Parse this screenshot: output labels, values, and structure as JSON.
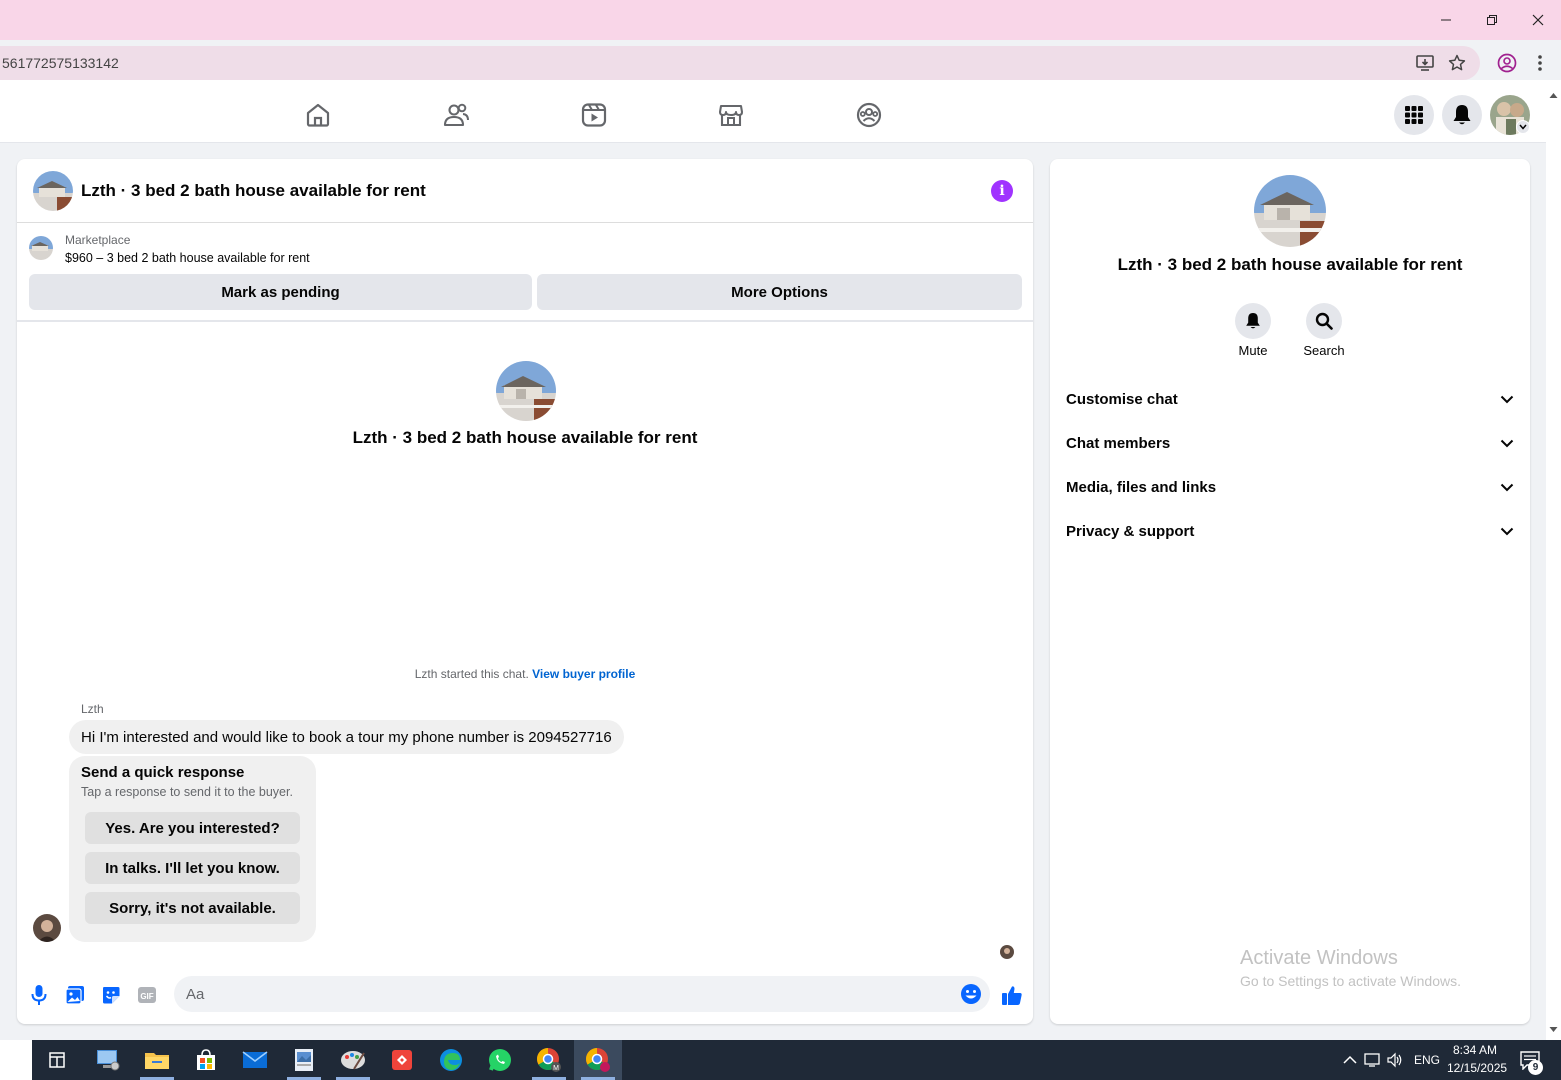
{
  "browser": {
    "address": "561772575133142"
  },
  "chat": {
    "header_title": "Lzth · 3 bed 2 bath house available for rent",
    "marketplace_label": "Marketplace",
    "listing": "$960 – 3 bed 2 bath house available for rent",
    "mark_pending_label": "Mark as pending",
    "more_options_label": "More Options",
    "center_title": "Lzth · 3 bed 2 bath house available for rent",
    "started_text": "Lzth started this chat.",
    "view_buyer_profile": "View buyer profile",
    "sender_name": "Lzth",
    "message": "Hi I'm interested and would like to book a tour my phone number is 2094527716",
    "quick_title": "Send a quick response",
    "quick_sub": "Tap a response to send it to the buyer.",
    "quick_replies": [
      "Yes. Are you interested?",
      "In talks. I'll let you know.",
      "Sorry, it's not available."
    ],
    "composer_placeholder": "Aa",
    "gif_label": "GIF"
  },
  "side": {
    "title": "Lzth · 3 bed 2 bath house available for rent",
    "mute_label": "Mute",
    "search_label": "Search",
    "rows": [
      "Customise chat",
      "Chat members",
      "Media, files and links",
      "Privacy & support"
    ]
  },
  "watermark": {
    "line1": "Activate Windows",
    "line2": "Go to Settings to activate Windows."
  },
  "taskbar": {
    "time": "8:34 AM",
    "date": "12/15/2025",
    "lang": "ENG",
    "notif_count": "9"
  },
  "colors": {
    "accent": "#a033ff",
    "link": "#0064d1",
    "like": "#0866ff",
    "titlebar": "#f9d6e8"
  }
}
